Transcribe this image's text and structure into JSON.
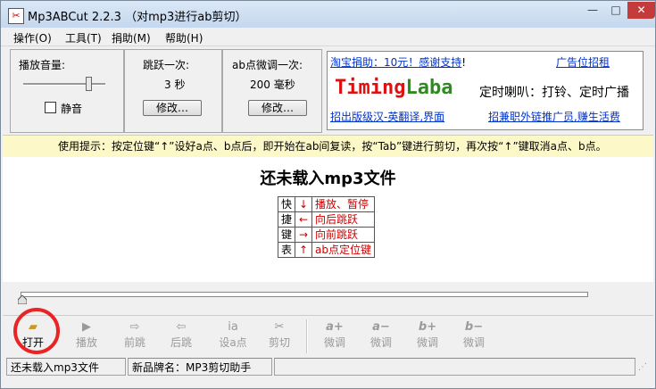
{
  "window": {
    "title": "Mp3ABCut 2.2.3 （对mp3进行ab剪切）",
    "minimize": "—",
    "maximize": "□",
    "close": "✕"
  },
  "menu": [
    "操作(O)",
    "工具(T)",
    "捐助(M)",
    "帮助(H)"
  ],
  "volume": {
    "label": "播放音量:",
    "mute_label": "静音",
    "muted": false
  },
  "skip": {
    "label": "跳跃一次:",
    "value": "3 秒",
    "button": "修改…"
  },
  "fine": {
    "label": "ab点微调一次:",
    "value": "200 毫秒",
    "button": "修改…"
  },
  "ad": {
    "donate_link": "淘宝捐助：10元！感谢支持",
    "donate_suffix": "!",
    "ad_recruit": "广告位招租",
    "brand": "TimingLaba",
    "slogan": "定时喇叭：打铃、定时广播",
    "link_left": "招出版级汉-英翻译,界面",
    "link_right": "招兼职外链推广员,赚生活费"
  },
  "tip": "使用提示：按定位键“↑”设好a点、b点后，即开始在ab间复读，按“Tab”键进行剪切，再次按“↑”键取消a点、b点。",
  "main_status": "还未载入mp3文件",
  "shortcut_table": {
    "title_chars": [
      "快",
      "捷",
      "键",
      "表"
    ],
    "rows": [
      {
        "key": "↓",
        "desc": "播放、暂停"
      },
      {
        "key": "←",
        "desc": "向后跳跃"
      },
      {
        "key": "→",
        "desc": "向前跳跃"
      },
      {
        "key": "↑",
        "desc": "ab点定位键"
      }
    ]
  },
  "toolbar": [
    {
      "icon": "📂",
      "label": "打开"
    },
    {
      "icon": "▶",
      "label": "播放"
    },
    {
      "icon": "⇨",
      "label": "前跳"
    },
    {
      "icon": "⇦",
      "label": "后跳"
    },
    {
      "icon": "ⅰa",
      "label": "设a点"
    },
    {
      "icon": "✂",
      "label": "剪切"
    },
    {
      "icon": "a+",
      "label": "微调"
    },
    {
      "icon": "a−",
      "label": "微调"
    },
    {
      "icon": "b+",
      "label": "微调"
    },
    {
      "icon": "b−",
      "label": "微调"
    }
  ],
  "statusbar": {
    "left": "还未载入mp3文件",
    "middle": "新品牌名：MP3剪切助手"
  },
  "colors": {
    "brand_red": "#dd1111",
    "brand_green": "#2e8b1f",
    "highlight_circle": "#e82424"
  }
}
